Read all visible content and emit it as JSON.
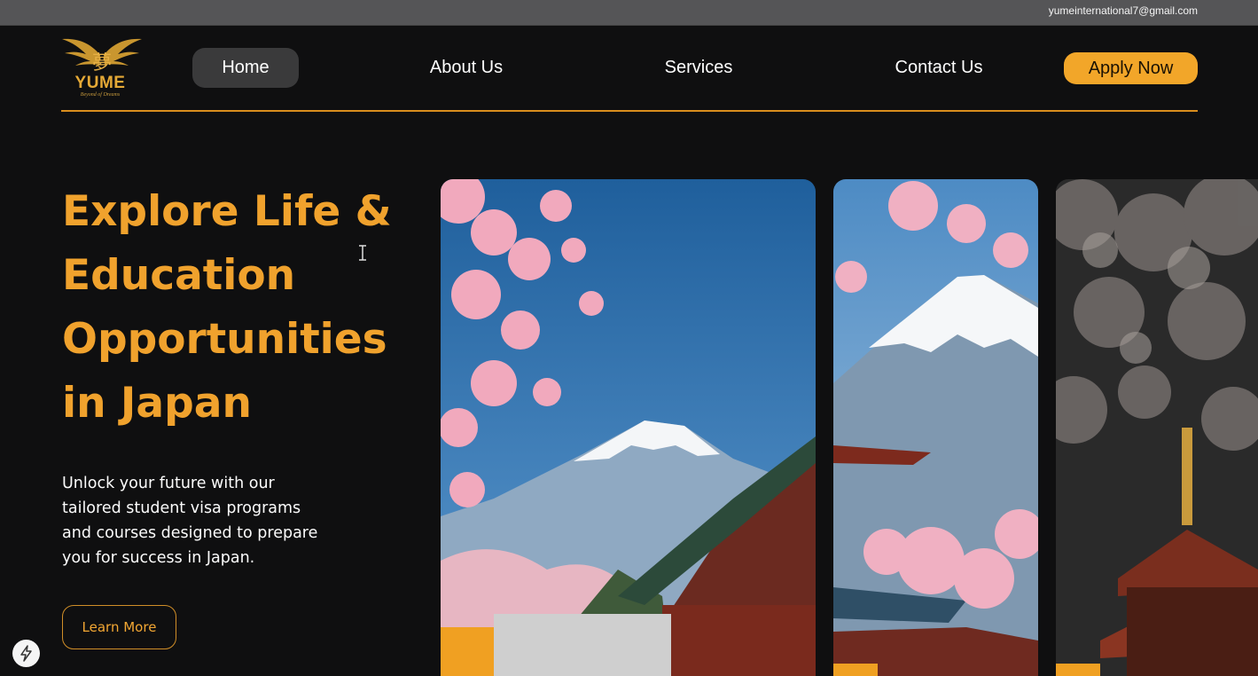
{
  "topbar": {
    "email": "yumeinternational7@gmail.com"
  },
  "logo": {
    "name": "YUME",
    "tagline": "Beyond of Dreams",
    "kanji": "夢"
  },
  "nav": {
    "items": [
      {
        "label": "Home",
        "active": true
      },
      {
        "label": "About Us"
      },
      {
        "label": "Services"
      },
      {
        "label": "Contact Us"
      }
    ],
    "apply_label": "Apply Now"
  },
  "hero": {
    "title": "Explore Life & Education Opportunities in Japan",
    "description": "Unlock your future with our tailored student visa programs and courses designed to prepare you for success in Japan.",
    "cta_label": "Learn More"
  },
  "colors": {
    "accent": "#f0a22d",
    "background": "#0f0f10",
    "nav_active": "#3a3a3b"
  },
  "icons": [
    "logo-wings-icon",
    "text-cursor-icon",
    "lightning-bolt-icon"
  ]
}
